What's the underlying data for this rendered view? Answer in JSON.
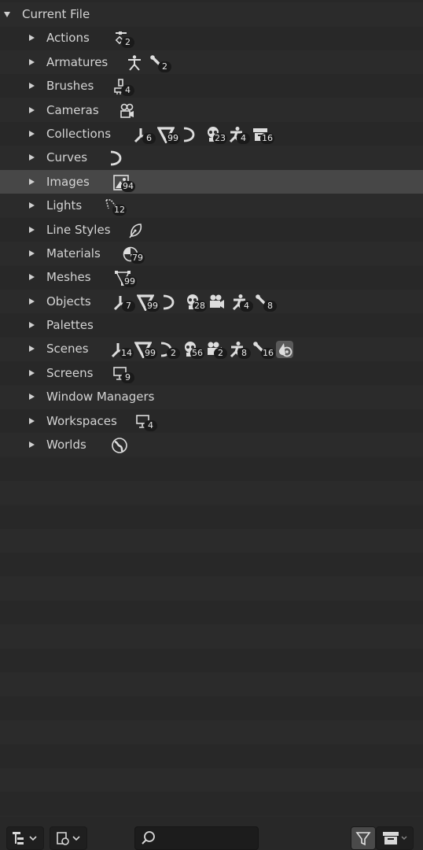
{
  "tree": {
    "root": {
      "label": "Current File"
    },
    "items": [
      {
        "label": "Actions",
        "icons": [
          {
            "name": "action-icon",
            "count": "2"
          }
        ]
      },
      {
        "label": "Armatures",
        "icons": [
          {
            "name": "armature-icon",
            "count": ""
          },
          {
            "name": "bone-icon",
            "count": "2"
          }
        ]
      },
      {
        "label": "Brushes",
        "icons": [
          {
            "name": "brush-icon",
            "count": "4"
          }
        ]
      },
      {
        "label": "Cameras",
        "icons": [
          {
            "name": "camera-icon",
            "count": ""
          }
        ]
      },
      {
        "label": "Collections",
        "icons": [
          {
            "name": "empty-axes-icon",
            "count": "6"
          },
          {
            "name": "mesh-icon",
            "count": "99"
          },
          {
            "name": "curve-icon",
            "count": ""
          },
          {
            "name": "skull-icon",
            "count": "23"
          },
          {
            "name": "pose-icon",
            "count": "4"
          },
          {
            "name": "collection-box-icon",
            "count": "16"
          }
        ]
      },
      {
        "label": "Curves",
        "icons": [
          {
            "name": "curve-icon",
            "count": ""
          }
        ]
      },
      {
        "label": "Images",
        "icons": [
          {
            "name": "image-icon",
            "count": "94"
          }
        ]
      },
      {
        "label": "Lights",
        "icons": [
          {
            "name": "light-icon",
            "count": "12"
          }
        ]
      },
      {
        "label": "Line Styles",
        "icons": [
          {
            "name": "line-style-icon",
            "count": ""
          }
        ]
      },
      {
        "label": "Materials",
        "icons": [
          {
            "name": "material-icon",
            "count": "79"
          }
        ]
      },
      {
        "label": "Meshes",
        "icons": [
          {
            "name": "mesh-data-icon",
            "count": "99"
          }
        ]
      },
      {
        "label": "Objects",
        "icons": [
          {
            "name": "empty-axes-icon",
            "count": "7"
          },
          {
            "name": "mesh-icon",
            "count": "99"
          },
          {
            "name": "curve-icon",
            "count": ""
          },
          {
            "name": "skull-icon",
            "count": "28"
          },
          {
            "name": "video-camera-icon",
            "count": ""
          },
          {
            "name": "pose-icon",
            "count": "4"
          },
          {
            "name": "bone-icon",
            "count": "8"
          }
        ]
      },
      {
        "label": "Palettes",
        "icons": []
      },
      {
        "label": "Scenes",
        "icons": [
          {
            "name": "empty-axes-icon",
            "count": "14"
          },
          {
            "name": "mesh-icon",
            "count": "99"
          },
          {
            "name": "curve-icon",
            "count": "2"
          },
          {
            "name": "skull-icon",
            "count": "56"
          },
          {
            "name": "video-camera-icon",
            "count": "2"
          },
          {
            "name": "pose-icon",
            "count": "8"
          },
          {
            "name": "bone-icon",
            "count": "16"
          },
          {
            "name": "scene-world-icon",
            "count": ""
          }
        ]
      },
      {
        "label": "Screens",
        "icons": [
          {
            "name": "screen-icon",
            "count": "9"
          }
        ]
      },
      {
        "label": "Window Managers",
        "icons": []
      },
      {
        "label": "Workspaces",
        "icons": [
          {
            "name": "screen-icon",
            "count": "4"
          }
        ]
      },
      {
        "label": "Worlds",
        "icons": [
          {
            "name": "world-icon",
            "count": ""
          }
        ]
      }
    ],
    "selected": "Images"
  },
  "footer": {
    "display_mode": "outliner-display-mode-icon",
    "filter_type": "filter-type-icon",
    "search_placeholder": "",
    "search_value": "",
    "filter": "funnel-icon",
    "archive": "archive-icon"
  }
}
